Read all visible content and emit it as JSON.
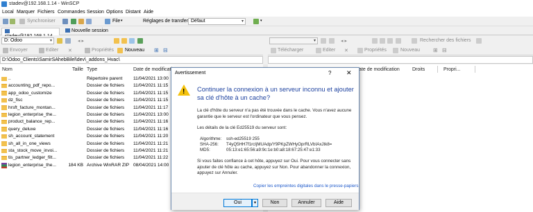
{
  "window": {
    "title": "stadev@192.168.1.14 - WinSCP"
  },
  "menu": [
    "Local",
    "Marquer",
    "Fichiers",
    "Commandes",
    "Session",
    "Options",
    "Distant",
    "Aide"
  ],
  "toolbar": {
    "sync_label": "Synchroniser",
    "file_label": "File",
    "transfer_settings_label": "Réglages de transfert",
    "transfer_settings_value": "Défaut"
  },
  "tabs": {
    "session": "stadev@192.168.1.14",
    "new_session": "Nouvelle session"
  },
  "left_pane": {
    "drive": "D: Odoo",
    "send_label": "Envoyer",
    "edit_label": "Editer",
    "properties_label": "Propriétés",
    "new_label": "Nouveau",
    "path": "D:\\Odoo_Clients\\SamirSAhebBilel\\dev\\_addons_Hvac\\",
    "columns": {
      "name": "Nom",
      "size": "Taille",
      "type": "Type",
      "date": "Date de modificatio"
    },
    "rows": [
      {
        "name": "..",
        "size": "",
        "type": "Répertoire parent",
        "date": "11/04/2021 13:00"
      },
      {
        "name": "accounting_pdf_repo...",
        "size": "",
        "type": "Dossier de fichiers",
        "date": "11/04/2021 11:15"
      },
      {
        "name": "app_odoo_customize",
        "size": "",
        "type": "Dossier de fichiers",
        "date": "11/04/2021 11:15"
      },
      {
        "name": "dz_fisc",
        "size": "",
        "type": "Dossier de fichiers",
        "date": "11/04/2021 11:15"
      },
      {
        "name": "hrsft_facture_montan...",
        "size": "",
        "type": "Dossier de fichiers",
        "date": "11/04/2021 11:17"
      },
      {
        "name": "legion_enterprise_the...",
        "size": "",
        "type": "Dossier de fichiers",
        "date": "11/04/2021 13:00"
      },
      {
        "name": "product_balance_rep...",
        "size": "",
        "type": "Dossier de fichiers",
        "date": "11/04/2021 11:16"
      },
      {
        "name": "query_deluxe",
        "size": "",
        "type": "Dossier de fichiers",
        "date": "11/04/2021 11:16"
      },
      {
        "name": "sh_account_statement",
        "size": "",
        "type": "Dossier de fichiers",
        "date": "11/04/2021 11:20"
      },
      {
        "name": "sh_all_in_one_views",
        "size": "",
        "type": "Dossier de fichiers",
        "date": "11/04/2021 11:21"
      },
      {
        "name": "sta_stock_move_invoi...",
        "size": "",
        "type": "Dossier de fichiers",
        "date": "11/04/2021 11:21"
      },
      {
        "name": "tis_partner_ledger_filt...",
        "size": "",
        "type": "Dossier de fichiers",
        "date": "11/04/2021 11:22"
      },
      {
        "name": "legion_enterprise_the...",
        "size": "184 KB",
        "type": "Archive WinRAR ZIP",
        "date": "08/04/2021 14:00"
      }
    ]
  },
  "right_pane": {
    "find_label": "Rechercher des fichiers",
    "download_label": "Télécharger",
    "edit_label": "Editer",
    "properties_label": "Propriétés",
    "new_label": "Nouveau",
    "columns": {
      "date": "Date de modification",
      "rights": "Droits",
      "owner": "Propri..."
    }
  },
  "dialog": {
    "title": "Avertissement",
    "help": "?",
    "close": "✕",
    "heading": "Continuer la connexion à un serveur inconnu et ajouter sa clé d'hôte à un cache?",
    "p1": "La clé d'hôte du serveur n'a pas été trouvée dans le cache. Vous n'avez aucune garantie que le serveur est l'ordinateur que vous pensez.",
    "p2": "Les détails de la clé Ed25519 du serveur sont:",
    "algo_key": "Algorithme:",
    "algo_val": "ssh-ed25519 255",
    "sha_key": "SHA-256:",
    "sha_val": "T4yQ5HH7f1rcIjMUAdp/Y9PKpZWHyOprRLVbIAxJtk8=",
    "md5_key": "MD5:",
    "md5_val": "05:13:e1:65:56:a9:9c:1e:b0:a8:18:67:25:47:e1:33",
    "p3": "Si vous faites confiance à cet hôte, appuyez sur Oui. Pour vous connecter sans ajouter de clé hôte au cache, appuyez sur Non. Pour abandonner la connexion, appuyez sur Annuler.",
    "link": "Copier les empreintes digitales dans le presse-papiers",
    "buttons": {
      "yes": "Oui",
      "no": "Non",
      "cancel": "Annuler",
      "help": "Aide"
    }
  },
  "colors": {
    "accent": "#0078d7",
    "heading": "#1a3f9e",
    "warning": "#f4c20d",
    "folder": "#f2c14e",
    "link": "#1a56c9"
  }
}
